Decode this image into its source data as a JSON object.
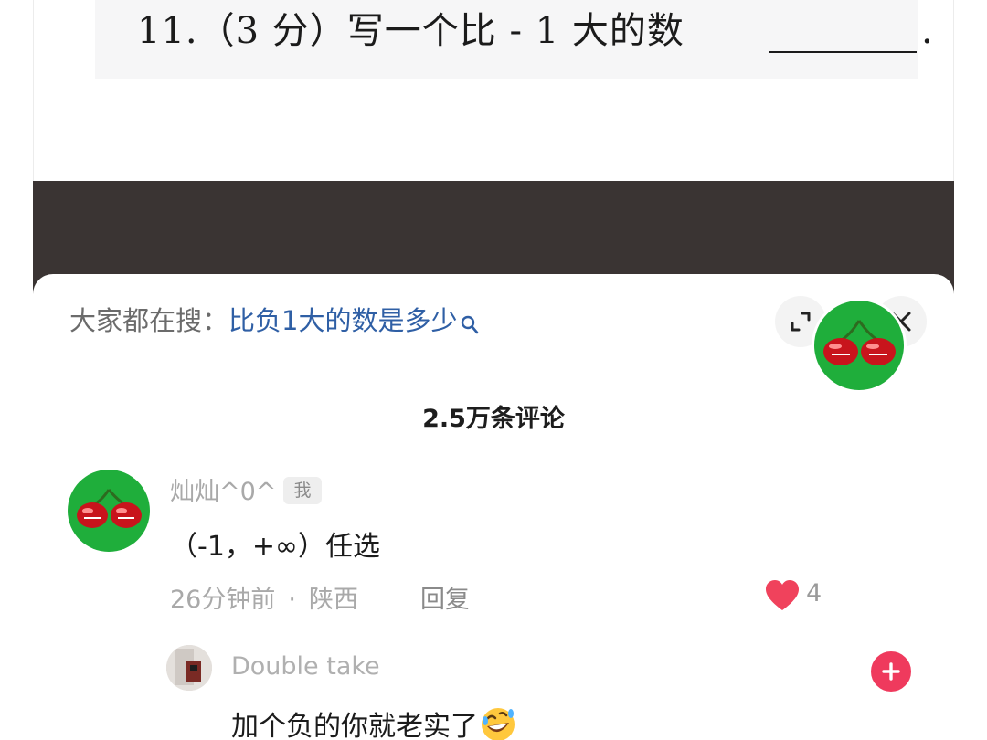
{
  "question": {
    "text": "11.（3 分）写一个比 - 1 大的数",
    "trailing_period": "."
  },
  "search_bar": {
    "prefix": "大家都在搜：",
    "query": "比负1大的数是多少",
    "icon": "search-icon"
  },
  "header_buttons": {
    "expand_icon": "expand-icon",
    "close_icon": "close-icon"
  },
  "comments_header": {
    "count_label": "2.5万条评论"
  },
  "comment": {
    "username": "灿灿^0^",
    "badge": "我",
    "text": "（-1，+∞）任选",
    "time": "26分钟前",
    "separator": "·",
    "location": "陕西",
    "reply_label": "回复",
    "like_count": "4",
    "like_color": "#f0425c"
  },
  "reply": {
    "username": "Double take",
    "text": "加个负的你就老实了",
    "emoji": "rolling-on-floor-laughing-emoji"
  },
  "colors": {
    "search_query": "#2f5fa5",
    "follow_button": "#ef3a5d",
    "video_strip": "#3a3433"
  }
}
